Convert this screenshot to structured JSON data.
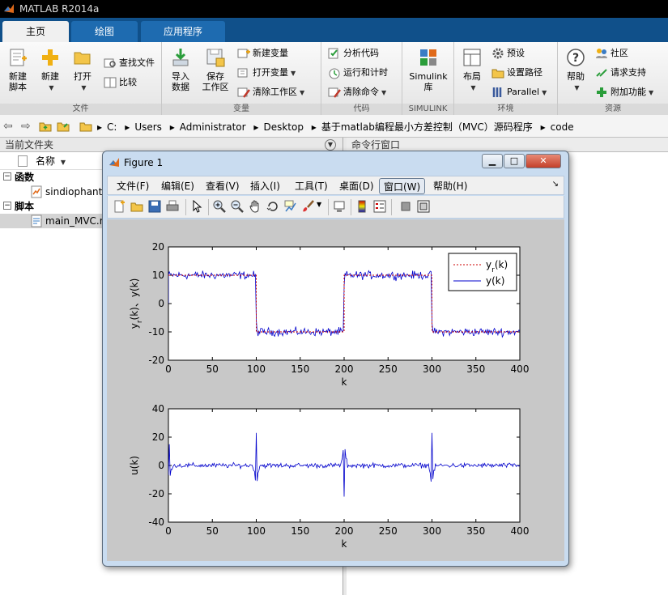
{
  "app": {
    "title": "MATLAB R2014a"
  },
  "tabs": [
    {
      "label": "主页",
      "active": true
    },
    {
      "label": "绘图"
    },
    {
      "label": "应用程序"
    }
  ],
  "ribbon": {
    "file": {
      "group_label": "文件",
      "new_script_line1": "新建",
      "new_script_line2": "脚本",
      "new_label": "新建",
      "open_label": "打开",
      "find_files": "查找文件",
      "compare": "比较"
    },
    "variable": {
      "group_label": "变量",
      "import_line1": "导入",
      "import_line2": "数据",
      "save_line1": "保存",
      "save_line2": "工作区",
      "new_variable": "新建变量",
      "open_variable": "打开变量",
      "clear_workspace": "清除工作区"
    },
    "code": {
      "group_label": "代码",
      "analyze": "分析代码",
      "run_and_time": "运行和计时",
      "clear_commands": "清除命令"
    },
    "simulink": {
      "group_label": "SIMULINK",
      "line1": "Simulink",
      "line2": "库"
    },
    "environment": {
      "group_label": "环境",
      "layout": "布局",
      "preferences": "预设",
      "set_path": "设置路径",
      "parallel": "Parallel"
    },
    "resources": {
      "group_label": "资源",
      "help": "帮助",
      "community": "社区",
      "request_support": "请求支持",
      "addons": "附加功能"
    }
  },
  "address": {
    "crumbs": [
      "C:",
      "Users",
      "Administrator",
      "Desktop",
      "基于matlab编程最小方差控制（MVC）源码程序",
      "code"
    ]
  },
  "current_folder": {
    "title": "当前文件夹",
    "name_header": "名称",
    "sections": [
      {
        "label": "函数",
        "items": [
          "sindiophant"
        ]
      },
      {
        "label": "脚本",
        "items": [
          "main_MVC.m"
        ]
      }
    ]
  },
  "command_window": {
    "title": "命令行窗口"
  },
  "figure": {
    "title": "Figure 1",
    "menu": [
      "文件(F)",
      "编辑(E)",
      "查看(V)",
      "插入(I)",
      "工具(T)",
      "桌面(D)",
      "窗口(W)",
      "帮助(H)"
    ],
    "active_menu": "窗口(W)"
  },
  "chart_data": [
    {
      "type": "line",
      "xlabel": "k",
      "ylabel_parts": [
        "y",
        "r",
        "(k)、y(k)"
      ],
      "xlim": [
        0,
        400
      ],
      "ylim": [
        -20,
        20
      ],
      "xticks": [
        0,
        50,
        100,
        150,
        200,
        250,
        300,
        350,
        400
      ],
      "yticks": [
        -20,
        -10,
        0,
        10,
        20
      ],
      "grid": false,
      "legend": "top-right",
      "series": [
        {
          "name": "y_r(k)",
          "legend_parts": [
            "y",
            "r",
            "(k)"
          ],
          "color": "#cc0000",
          "style": "dotted",
          "segments": [
            {
              "x": [
                0,
                100
              ],
              "y": 10
            },
            {
              "x": [
                100,
                200
              ],
              "y": -10
            },
            {
              "x": [
                200,
                300
              ],
              "y": 10
            },
            {
              "x": [
                300,
                400
              ],
              "y": -10
            }
          ]
        },
        {
          "name": "y(k)",
          "legend_parts": [
            "y(k)"
          ],
          "color": "#0000cc",
          "style": "solid",
          "description": "noisy tracking of square wave, amplitude ±10 with noise ~±3"
        }
      ]
    },
    {
      "type": "line",
      "xlabel": "k",
      "ylabel": "u(k)",
      "xlim": [
        0,
        400
      ],
      "ylim": [
        -40,
        40
      ],
      "xticks": [
        0,
        50,
        100,
        150,
        200,
        250,
        300,
        350,
        400
      ],
      "yticks": [
        -40,
        -20,
        0,
        20,
        40
      ],
      "grid": false,
      "series": [
        {
          "name": "u(k)",
          "color": "#0000cc",
          "spikes": [
            {
              "x": 1,
              "value": 15
            },
            {
              "x": 100,
              "value": 23
            },
            {
              "x": 200,
              "value": -22
            },
            {
              "x": 300,
              "value": 23
            }
          ]
        }
      ]
    }
  ]
}
